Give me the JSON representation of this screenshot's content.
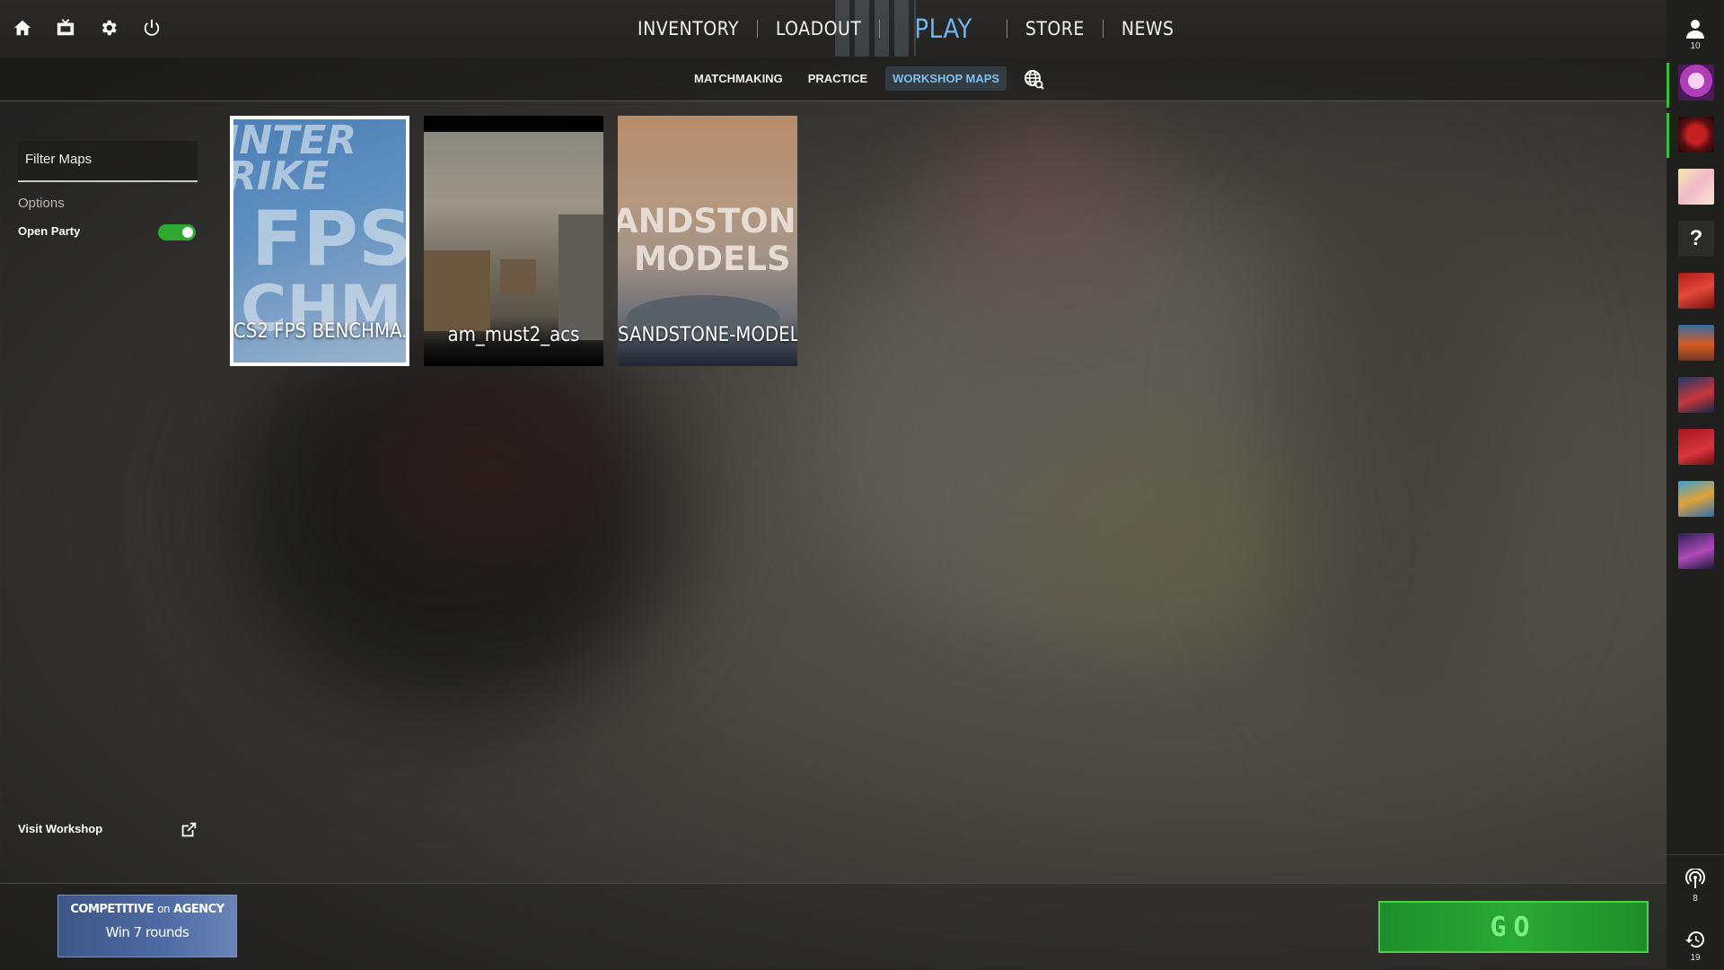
{
  "top_nav": {
    "tabs": [
      "INVENTORY",
      "LOADOUT",
      "PLAY",
      "STORE",
      "NEWS"
    ],
    "active_tab": "PLAY"
  },
  "sub_nav": {
    "tabs": [
      "MATCHMAKING",
      "PRACTICE",
      "WORKSHOP MAPS"
    ],
    "active_tab": "WORKSHOP MAPS"
  },
  "left_panel": {
    "filter_placeholder": "Filter Maps",
    "options_label": "Options",
    "open_party_label": "Open Party",
    "open_party_enabled": true,
    "visit_workshop_label": "Visit Workshop"
  },
  "maps": [
    {
      "title": "CS2 FPS BENCHMA...",
      "art_text": [
        "INTER",
        "RIKE",
        "FPS",
        "CHM"
      ],
      "selected": true
    },
    {
      "title": "am_must2_acs",
      "selected": false
    },
    {
      "title": "SANDSTONE-MODEL...",
      "art_text": [
        "ANDSTON",
        "MODELS"
      ],
      "selected": false
    }
  ],
  "right_rail": {
    "friends_count": "10",
    "broadcast_count": "8",
    "history_count": "19",
    "avatars": [
      "skull-avatar",
      "red-demon-avatar",
      "anime-avatar",
      "unknown-avatar",
      "red-character-avatar",
      "car-avatar",
      "blue-character-avatar",
      "red-logo-avatar",
      "cartoon-avatar",
      "purple-avatar"
    ],
    "unknown_glyph": "?"
  },
  "mission": {
    "line1_a": "COMPETITIVE",
    "line1_on": "on",
    "line1_b": "AGENCY",
    "line2": "Win 7 rounds"
  },
  "go_button_label": "GO",
  "colors": {
    "accent_blue": "#6fb4e8",
    "toggle_green": "#2fa82f",
    "go_green": "#2aa936"
  }
}
